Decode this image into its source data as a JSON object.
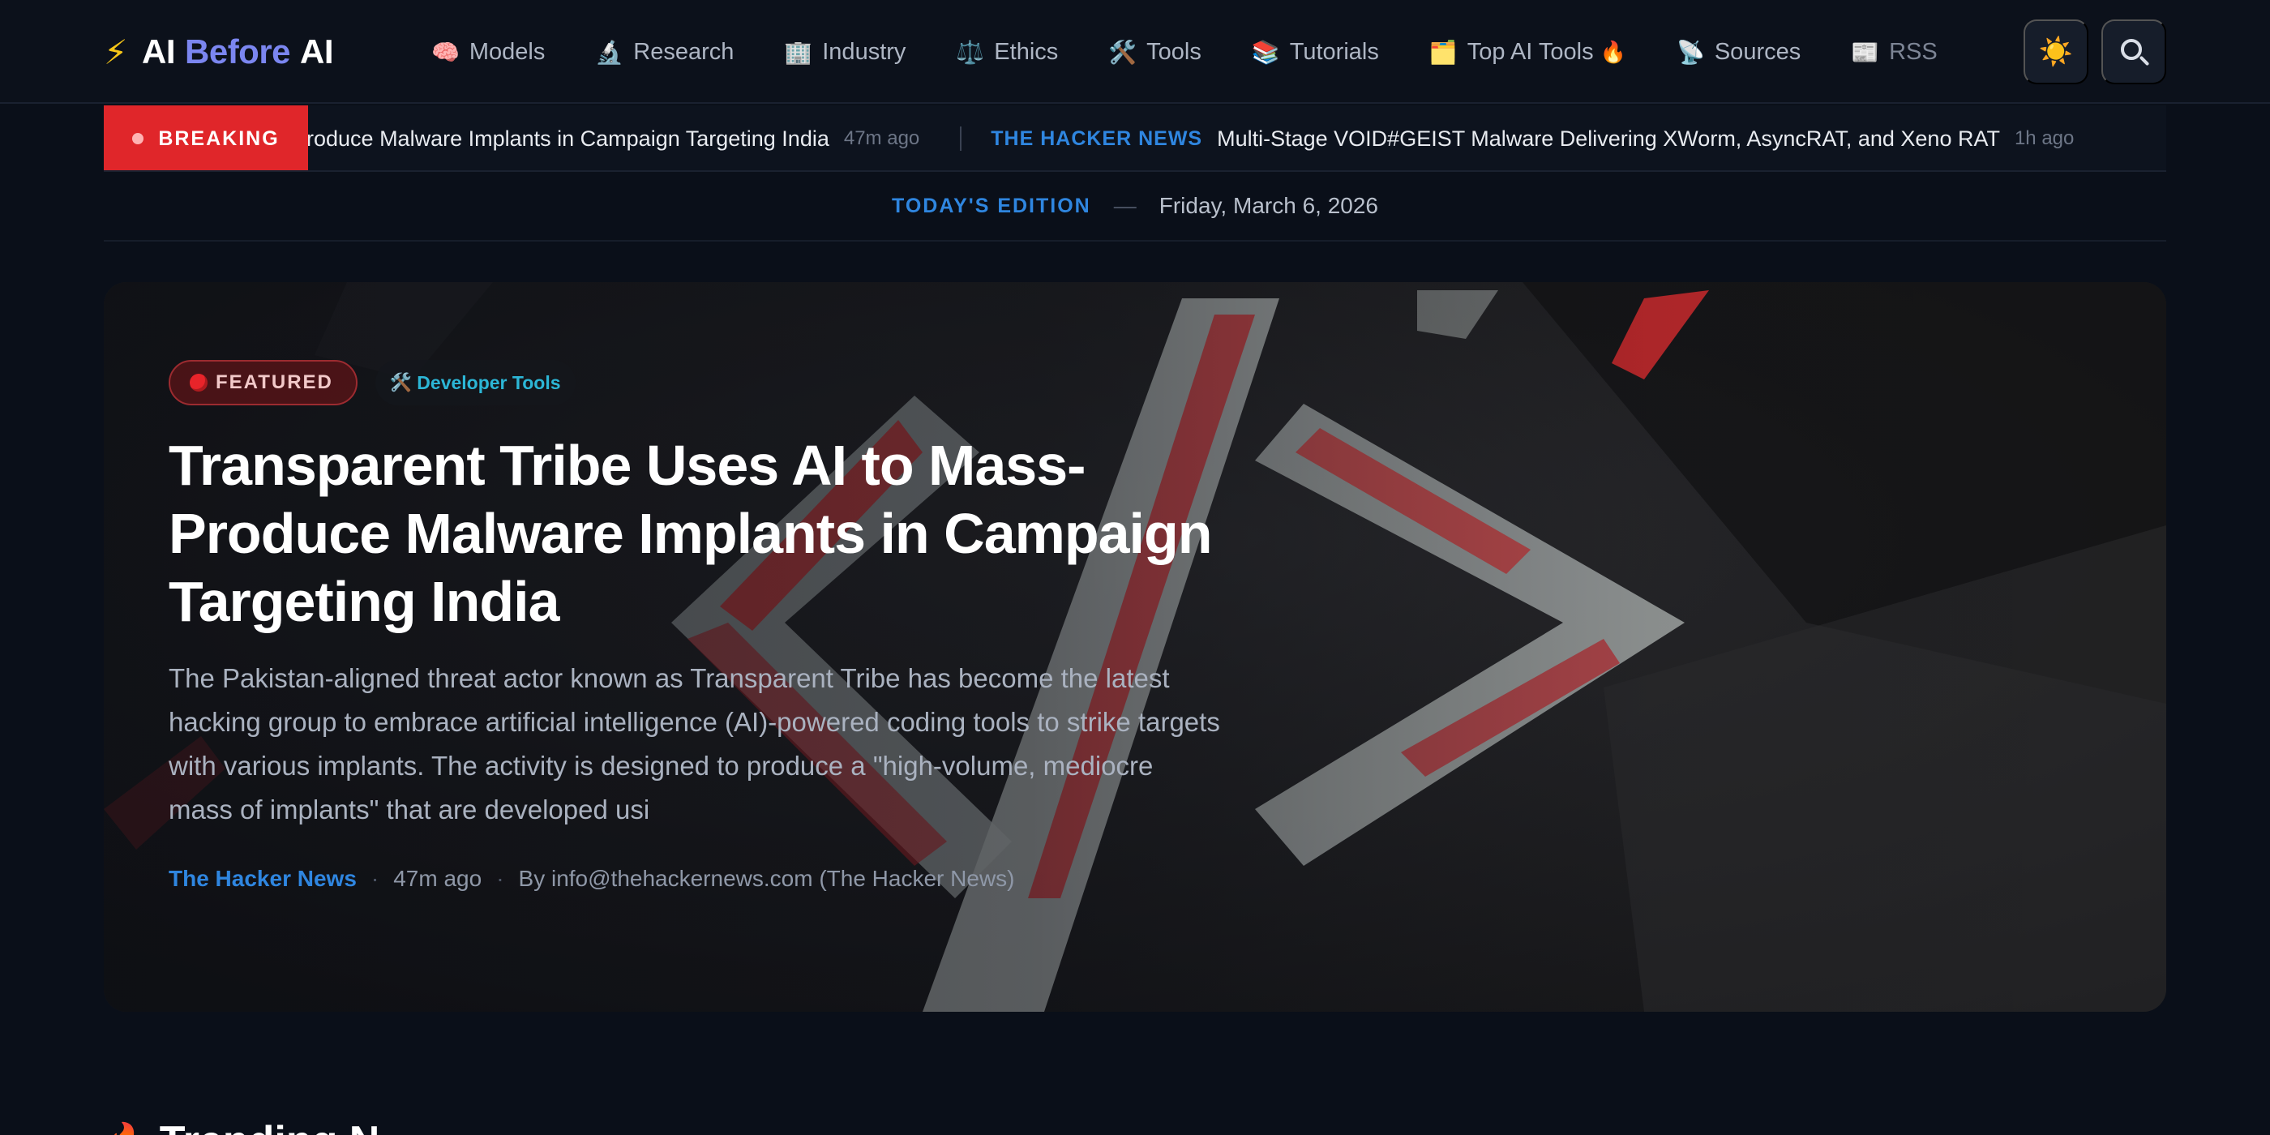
{
  "header": {
    "logo": {
      "bolt": "⚡",
      "part1": "AI",
      "part2": "Before",
      "part3": "AI"
    },
    "nav": [
      {
        "icon": "🧠",
        "label": "Models"
      },
      {
        "icon": "🔬",
        "label": "Research"
      },
      {
        "icon": "🏢",
        "label": "Industry"
      },
      {
        "icon": "⚖️",
        "label": "Ethics"
      },
      {
        "icon": "🛠️",
        "label": "Tools"
      },
      {
        "icon": "📚",
        "label": "Tutorials"
      },
      {
        "icon": "🗂️",
        "label": "Top AI Tools",
        "suffix": "🔥"
      },
      {
        "icon": "📡",
        "label": "Sources"
      },
      {
        "icon": "📰",
        "label": "RSS"
      }
    ],
    "theme_toggle_icon": "☀️",
    "search_icon": "search-icon"
  },
  "breaking": {
    "label": "BREAKING",
    "items": [
      {
        "title": "Produce Malware Implants in Campaign Targeting India",
        "time": "47m ago"
      },
      {
        "source": "THE HACKER NEWS",
        "title": "Multi-Stage VOID#GEIST Malware Delivering XWorm, AsyncRAT, and Xeno RAT",
        "time": "1h ago"
      }
    ]
  },
  "edition": {
    "label": "TODAY'S EDITION",
    "dash": "—",
    "date": "Friday, March 6, 2026"
  },
  "featured": {
    "badge": "FEATURED",
    "tag_icon": "🛠️",
    "tag": "Developer Tools",
    "title": "Transparent Tribe Uses AI to Mass-Produce Malware Implants in Campaign Targeting India",
    "excerpt": "The Pakistan-aligned threat actor known as Transparent Tribe has become the latest hacking group to embrace artificial intelligence (AI)-powered coding tools to strike targets with various implants. The activity is designed to produce a \"high-volume, mediocre mass of implants\" that are developed usi",
    "source": "The Hacker News",
    "time": "47m ago",
    "author": "By info@thehackernews.com (The Hacker News)"
  },
  "trending": {
    "icon": "🔥",
    "title": "Trending N"
  },
  "colors": {
    "accent": "#2f86e0",
    "breaking": "#e0262a",
    "logo_purple": "#7b86f0"
  }
}
